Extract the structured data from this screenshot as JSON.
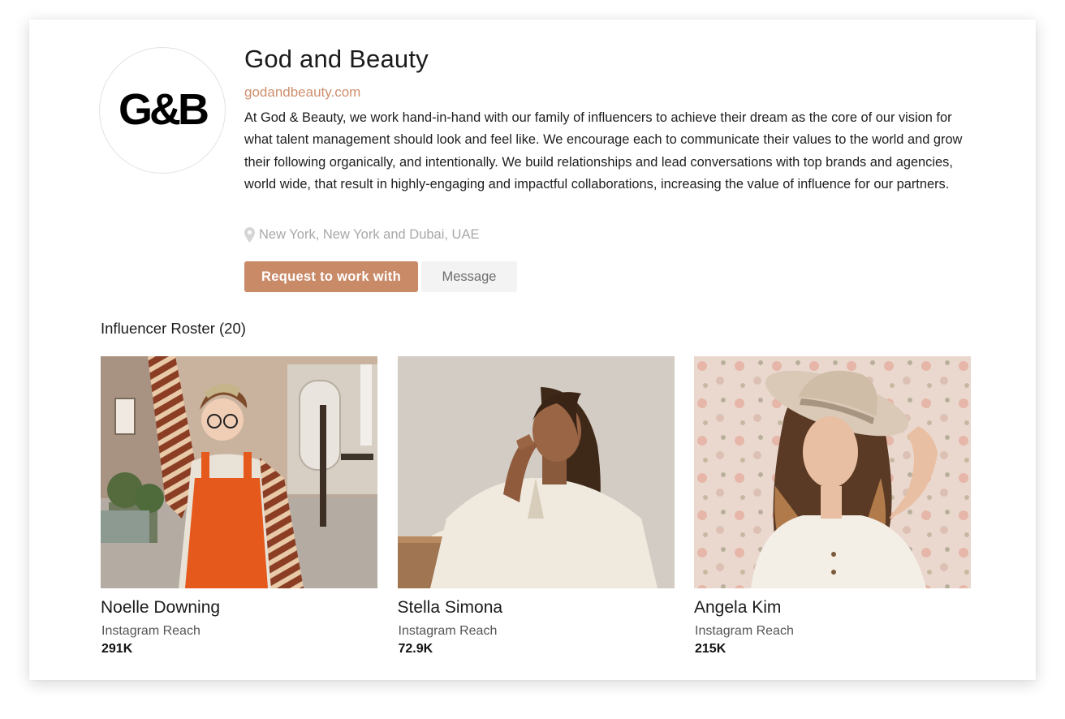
{
  "agency": {
    "name": "God and Beauty",
    "logo_text": "G&B",
    "website": "godandbeauty.com",
    "description": "At God & Beauty, we work hand-in-hand with our family of influencers to achieve their dream as the core of our vision for what talent management should look and feel like. We encourage each to communicate their values to the world and grow their following organically, and intentionally. We build relationships and lead conversations with top brands and agencies, world wide, that result in highly-engaging and impactful collaborations, increasing the value of influence for our partners.",
    "location": "New York, New York and Dubai, UAE",
    "location_icon": "map-pin-icon"
  },
  "actions": {
    "request_label": "Request to work with",
    "message_label": "Message"
  },
  "roster": {
    "heading": "Influencer Roster (20)",
    "influencers": [
      {
        "name": "Noelle Downing",
        "reach_label": "Instagram Reach",
        "reach_value": "291K"
      },
      {
        "name": "Stella Simona",
        "reach_label": "Instagram Reach",
        "reach_value": "72.9K"
      },
      {
        "name": "Angela Kim",
        "reach_label": "Instagram Reach",
        "reach_value": "215K"
      }
    ]
  },
  "colors": {
    "accent": "#c98a68",
    "link": "#cf8f6e",
    "secondary_button_bg": "#f3f3f3",
    "muted_text": "#a8a8a8"
  }
}
